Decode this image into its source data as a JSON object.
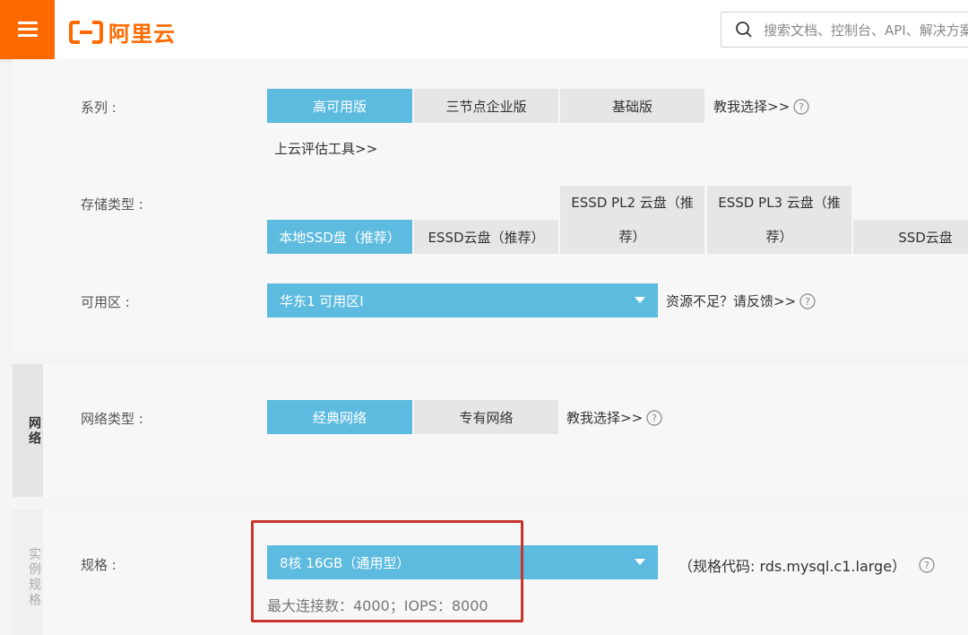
{
  "header": {
    "logo_text": "阿里云",
    "search_placeholder": "搜索文档、控制台、API、解决方案"
  },
  "sections": {
    "network_tab": "网络",
    "spec_tab": "实例规格"
  },
  "series": {
    "label": "系列 :",
    "options": [
      "高可用版",
      "三节点企业版",
      "基础版"
    ],
    "selected": 0,
    "help": "教我选择>>",
    "tool_link": "上云评估工具>>"
  },
  "storage": {
    "label": "存储类型 :",
    "options": [
      "本地SSD盘（推荐）",
      "ESSD云盘（推荐）",
      "ESSD PL2 云盘（推荐）",
      "ESSD PL3 云盘（推荐）",
      "SSD云盘"
    ],
    "selected": 0
  },
  "zone": {
    "label": "可用区 :",
    "value": "华东1 可用区I",
    "help": "资源不足？请反馈>>"
  },
  "network": {
    "label": "网络类型 :",
    "options": [
      "经典网络",
      "专有网络"
    ],
    "selected": 0,
    "help": "教我选择>>"
  },
  "spec": {
    "label": "规格 :",
    "value": "8核 16GB（通用型）",
    "code": "（规格代码: rds.mysql.c1.large）",
    "detail": "最大连接数：4000；IOPS：8000"
  },
  "colors": {
    "brand": "#ff6a00",
    "selected": "#5dbbe0",
    "highlight": "#c7352b"
  }
}
